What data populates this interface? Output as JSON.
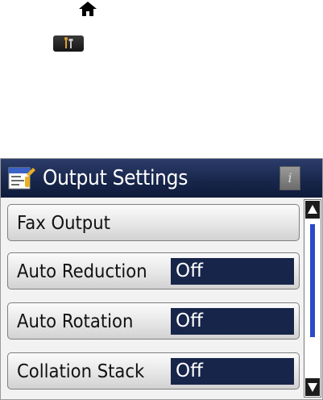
{
  "icons": {
    "home": "home-icon",
    "setup": "setup-icon",
    "settings": "output-settings-icon",
    "info": "info-icon",
    "scroll_up": "scroll-up-arrow-icon",
    "scroll_down": "scroll-down-arrow-icon"
  },
  "panel": {
    "title": "Output Settings",
    "info_label": "i",
    "colors": {
      "titlebar": "#17254a",
      "value_bg": "#17254a",
      "scroll_thumb": "#2a49c9"
    },
    "rows": [
      {
        "label": "Fax Output"
      },
      {
        "label": "Auto Reduction",
        "value": "Off"
      },
      {
        "label": "Auto Rotation",
        "value": "Off"
      },
      {
        "label": "Collation Stack",
        "value": "Off"
      }
    ]
  }
}
